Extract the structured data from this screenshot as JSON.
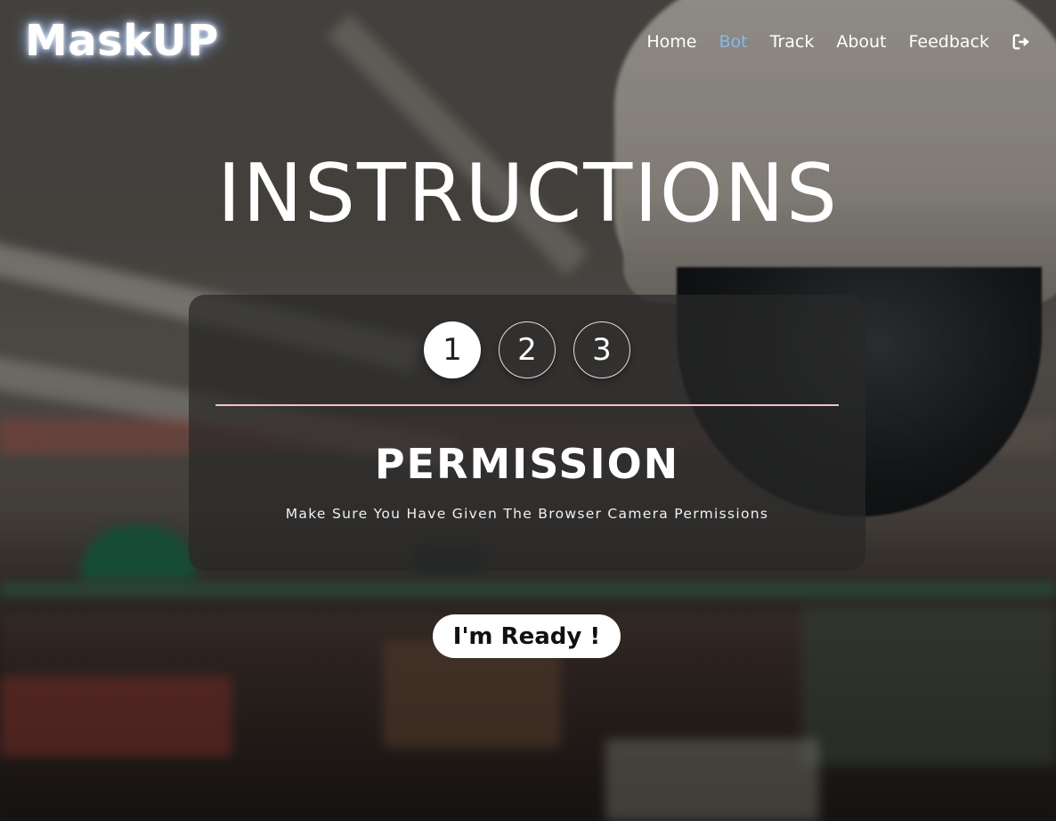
{
  "brand": {
    "logo_text": "MaskUP"
  },
  "nav": {
    "items": [
      {
        "label": "Home",
        "active": false
      },
      {
        "label": "Bot",
        "active": true
      },
      {
        "label": "Track",
        "active": false
      },
      {
        "label": "About",
        "active": false
      },
      {
        "label": "Feedback",
        "active": false
      }
    ],
    "logout_icon": "logout-icon",
    "active_color": "#86b8e6"
  },
  "main": {
    "title": "INSTRUCTIONS",
    "steps": [
      {
        "label": "1",
        "active": true
      },
      {
        "label": "2",
        "active": false
      },
      {
        "label": "3",
        "active": false
      }
    ],
    "current_step": {
      "title": "PERMISSION",
      "description": "Make Sure You Have Given The Browser Camera Permissions"
    },
    "ready_button": "I'm Ready !"
  },
  "colors": {
    "divider": "#f2c1c8",
    "card_bg": "rgba(40,40,40,0.72)"
  }
}
